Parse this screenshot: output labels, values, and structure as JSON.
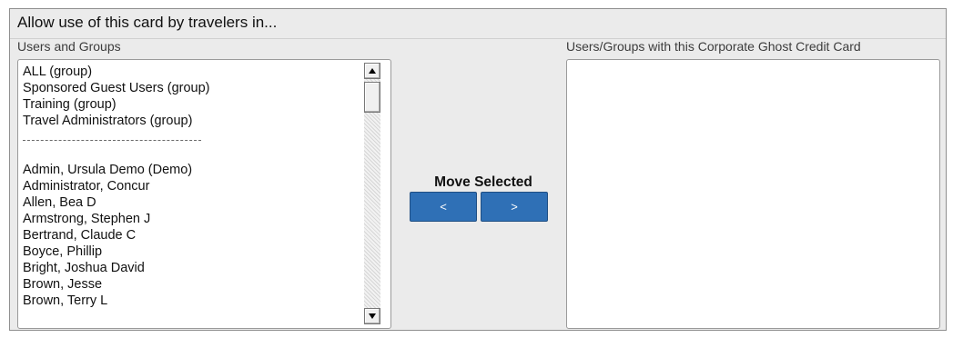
{
  "panel": {
    "title": "Allow use of this card by travelers in..."
  },
  "available": {
    "label": "Users and Groups",
    "groups": [
      "ALL (group)",
      "Sponsored Guest Users (group)",
      "Training (group)",
      "Travel Administrators (group)"
    ],
    "users": [
      "Admin, Ursula Demo (Demo)",
      "Administrator, Concur",
      "Allen, Bea D",
      "Armstrong, Stephen J",
      "Bertrand, Claude C",
      "Boyce, Phillip",
      "Bright, Joshua David",
      "Brown, Jesse",
      "Brown, Terry L"
    ]
  },
  "selected": {
    "label": "Users/Groups with this Corporate Ghost Credit Card",
    "items": []
  },
  "move": {
    "label": "Move Selected",
    "left_label": "<",
    "right_label": ">"
  },
  "colors": {
    "button_blue": "#2f70b6",
    "panel_bg": "#ebebeb"
  },
  "icons": {
    "scroll_up": "scroll-up-arrow-icon",
    "scroll_down": "scroll-down-arrow-icon"
  }
}
